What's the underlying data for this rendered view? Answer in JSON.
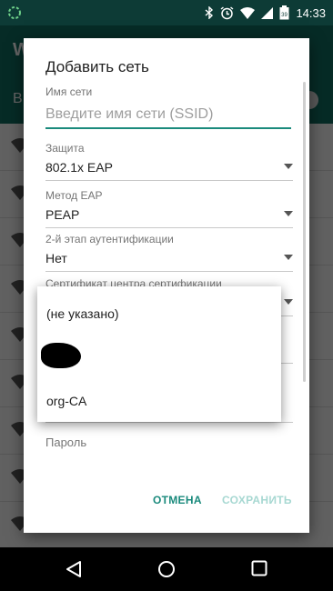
{
  "status_bar": {
    "time": "14:33",
    "battery_level": "39",
    "icons": [
      "sync-icon",
      "bluetooth-icon",
      "alarm-icon",
      "wifi-icon",
      "signal-icon",
      "battery-icon"
    ]
  },
  "dialog": {
    "title": "Добавить сеть",
    "ssid_label": "Имя сети",
    "ssid_placeholder": "Введите имя сети (SSID)",
    "ssid_value": "",
    "security_label": "Защита",
    "security_value": "802.1x EAP",
    "eap_label": "Метод EAP",
    "eap_value": "PEAP",
    "phase2_label": "2-й этап аутентификации",
    "phase2_value": "Нет",
    "cert_label": "Сертификат центра сертификации",
    "password_label": "Пароль",
    "cancel_label": "ОТМЕНА",
    "save_label": "СОХРАНИТЬ"
  },
  "cert_dropdown": {
    "options": [
      "(не указано)",
      "",
      "org-CA"
    ]
  },
  "colors": {
    "accent": "#1a8a7c",
    "accent_disabled": "#a7d8d2",
    "app_bar": "#0f6b60",
    "status_bar": "#0d3b36"
  },
  "nav": {
    "icons": [
      "back-icon",
      "home-icon",
      "recents-icon"
    ]
  }
}
